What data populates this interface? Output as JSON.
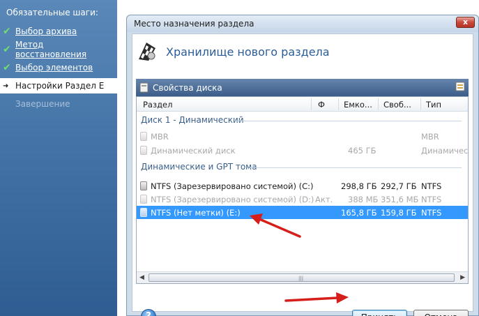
{
  "sidebar": {
    "header": "Обязательные шаги:",
    "items": [
      {
        "label": "Выбор архива",
        "state": "done"
      },
      {
        "label": "Метод восстановления",
        "state": "done"
      },
      {
        "label": "Выбор элементов",
        "state": "done"
      },
      {
        "label": "Настройки Раздел E",
        "state": "active"
      },
      {
        "label": "Завершение",
        "state": "disabled"
      }
    ]
  },
  "dialog": {
    "title": "Место назначения раздела",
    "close_label": "x",
    "header_title": "Хранилище нового раздела",
    "properties_label": "Свойства диска",
    "columns": [
      "Раздел",
      "Ф",
      "Емко...",
      "Своб...",
      "Тип"
    ],
    "groups": [
      {
        "name": "Диск 1 - Динамический",
        "rows": [
          {
            "name": "MBR",
            "fs": "",
            "capacity": "",
            "free": "",
            "type": "MBR",
            "state": "disabled"
          },
          {
            "name": "Динамический диск",
            "fs": "",
            "capacity": "465 ГБ",
            "free": "",
            "type": "Динамическ",
            "state": "disabled"
          }
        ]
      },
      {
        "name": "Динамические и GPT тома",
        "rows": [
          {
            "name": "NTFS (Зарезервировано системой) (C:)",
            "fs": "",
            "capacity": "298,8 ГБ",
            "free": "292,7 ГБ",
            "type": "NTFS",
            "state": "normal"
          },
          {
            "name": "NTFS (Зарезервировано системой) (D:)",
            "fs": "Акт.",
            "capacity": "388 МБ",
            "free": "351,6 МБ",
            "type": "NTFS",
            "state": "disabled"
          },
          {
            "name": "NTFS (Нет метки) (E:)",
            "fs": "",
            "capacity": "165,8 ГБ",
            "free": "159,8 ГБ",
            "type": "NTFS",
            "state": "selected"
          }
        ]
      }
    ],
    "help_label": "?",
    "accept_label": "Принять",
    "cancel_label": "Отмена"
  },
  "colors": {
    "selection": "#3399ff",
    "accent_title": "#2a5c9a",
    "arrow": "#e0201c"
  },
  "icons": [
    "check-icon",
    "arrow-right-icon",
    "wizard-flag-icon",
    "disk-properties-icon",
    "disk-icon",
    "help-icon",
    "close-icon"
  ]
}
